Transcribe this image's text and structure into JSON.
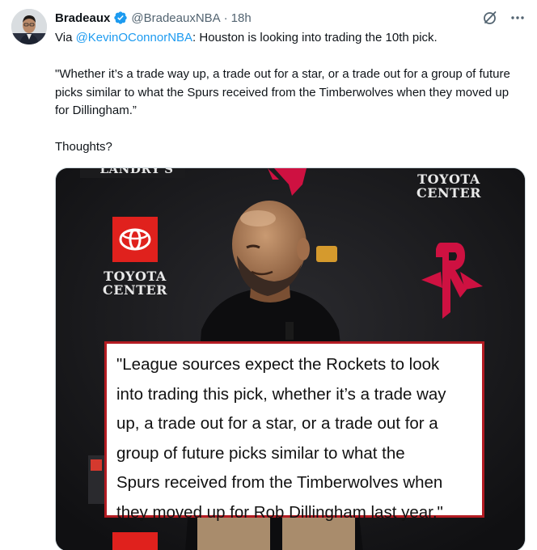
{
  "tweet": {
    "display_name": "Bradeaux",
    "handle": "@BradeauxNBA",
    "separator": "·",
    "time": "18h",
    "verified_icon": "verified-badge-icon",
    "grok_icon": "grok-icon",
    "more_icon": "more-icon",
    "text": {
      "prefix": "Via ",
      "mention": "@KevinOConnorNBA",
      "line1_rest": ": Houston is looking into trading the 10th pick.",
      "paragraph2": "\"Whether it’s a trade way up, a trade out for a star, or a trade out for a group of future picks similar to what the Spurs received from the Timberwolves when they moved up for Dillingham.”",
      "paragraph3": "Thoughts?"
    }
  },
  "media": {
    "backdrop_top_text": "LANDRY'S",
    "toyota_center_left": [
      "TOYOTA",
      "CENTER"
    ],
    "toyota_center_right": [
      "TOYOTA",
      "CENTER"
    ],
    "quote_lines": [
      "\"League sources expect the Rockets to look",
      "into trading this pick, whether it’s a trade way",
      "up, a trade out for a star, or a trade out for a",
      "group of future picks similar to what the",
      "Spurs received from the Timberwolves when",
      "they moved up for Rob Dillingham last year,\""
    ]
  },
  "colors": {
    "link": "#1d9bf0",
    "secondary_text": "#536471",
    "quote_border": "#b31b22",
    "rockets_red": "#ce1141",
    "toyota_red": "#e0211d"
  }
}
